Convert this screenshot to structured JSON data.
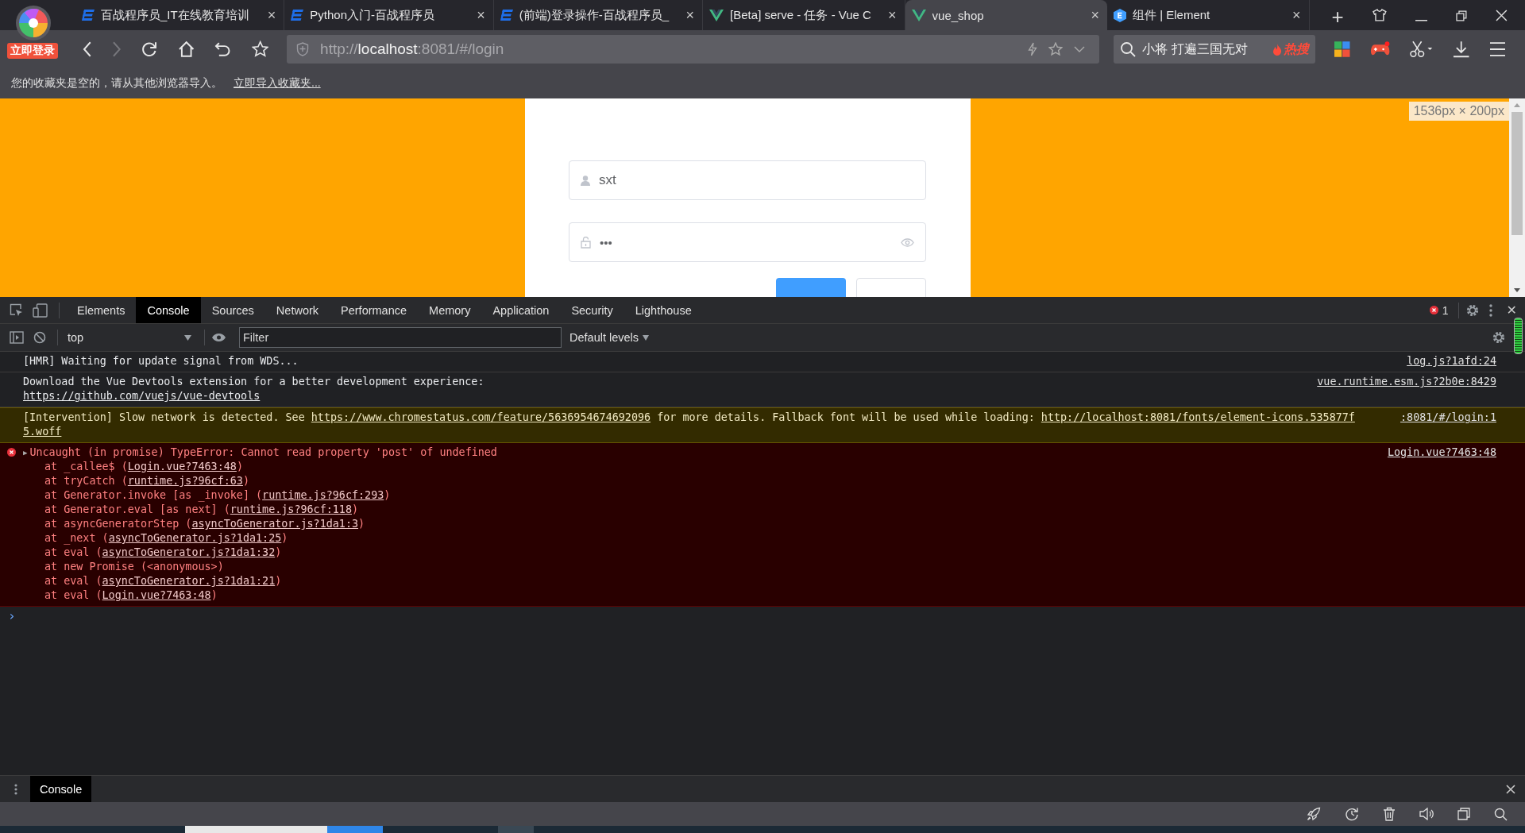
{
  "browser": {
    "login_badge": "立即登录",
    "tabs": [
      {
        "title": "百战程序员_IT在线教育培训",
        "kind": "bz",
        "selected": false,
        "close": "×"
      },
      {
        "title": "Python入门-百战程序员",
        "kind": "bz",
        "selected": false,
        "close": "×"
      },
      {
        "title": "(前端)登录操作-百战程序员_",
        "kind": "bz",
        "selected": false,
        "close": "×"
      },
      {
        "title": "[Beta] serve - 任务 - Vue C",
        "kind": "vue",
        "selected": false,
        "close": "×"
      },
      {
        "title": "vue_shop",
        "kind": "vue",
        "selected": true,
        "close": "×"
      },
      {
        "title": "组件 | Element",
        "kind": "element",
        "selected": false,
        "close": "×"
      }
    ],
    "new_tab": "+",
    "address": {
      "scheme": "http://",
      "host": "localhost",
      "rest": ":8081/#/login"
    },
    "search": {
      "value": "小将 打遍三国无对",
      "hot": "热搜"
    },
    "bookmarks": {
      "message": "您的收藏夹是空的，请从其他浏览器导入。",
      "link": "立即导入收藏夹..."
    }
  },
  "page": {
    "size_label": "1536px × 200px",
    "username": "sxt",
    "password": "•••"
  },
  "devtools": {
    "tabs": [
      {
        "label": "Elements",
        "selected": false
      },
      {
        "label": "Console",
        "selected": true
      },
      {
        "label": "Sources",
        "selected": false
      },
      {
        "label": "Network",
        "selected": false
      },
      {
        "label": "Performance",
        "selected": false
      },
      {
        "label": "Memory",
        "selected": false
      },
      {
        "label": "Application",
        "selected": false
      },
      {
        "label": "Security",
        "selected": false
      },
      {
        "label": "Lighthouse",
        "selected": false
      }
    ],
    "error_count": "1",
    "close": "✕",
    "context": "top",
    "filter_placeholder": "Filter",
    "levels": "Default levels",
    "messages": [
      {
        "kind": "info",
        "source": "log.js?1afd:24",
        "lines": [
          [
            {
              "text": "[HMR] Waiting for update signal from WDS...",
              "kind": "text"
            }
          ]
        ]
      },
      {
        "kind": "info",
        "source": "vue.runtime.esm.js?2b0e:8429",
        "lines": [
          [
            {
              "text": "Download the Vue Devtools extension for a better development experience:",
              "kind": "text"
            }
          ],
          [
            {
              "text": "https://github.com/vuejs/vue-devtools",
              "kind": "link"
            }
          ]
        ]
      },
      {
        "kind": "warning",
        "source": ":8081/#/login:1",
        "lines": [
          [
            {
              "text": "[Intervention] Slow network is detected. See ",
              "kind": "text"
            },
            {
              "text": "https://www.chromestatus.com/feature/5636954674692096",
              "kind": "link"
            },
            {
              "text": " for more details. Fallback font will be used while loading: ",
              "kind": "text"
            },
            {
              "text": "http://localhost:8081/fonts/element-icons.535877f",
              "kind": "link"
            }
          ],
          [
            {
              "text": "5.woff",
              "kind": "link"
            }
          ]
        ]
      },
      {
        "kind": "error",
        "toggle": "▶",
        "source": "Login.vue?7463:48",
        "lines": [
          [
            {
              "text": "Uncaught (in promise) TypeError: Cannot read property 'post' of undefined",
              "kind": "text"
            }
          ],
          [
            {
              "text": "at _callee$ (",
              "kind": "text"
            },
            {
              "text": "Login.vue?7463:48",
              "kind": "link"
            },
            {
              "text": ")",
              "kind": "text"
            }
          ],
          [
            {
              "text": "at tryCatch (",
              "kind": "text"
            },
            {
              "text": "runtime.js?96cf:63",
              "kind": "link"
            },
            {
              "text": ")",
              "kind": "text"
            }
          ],
          [
            {
              "text": "at Generator.invoke [as _invoke] (",
              "kind": "text"
            },
            {
              "text": "runtime.js?96cf:293",
              "kind": "link"
            },
            {
              "text": ")",
              "kind": "text"
            }
          ],
          [
            {
              "text": "at Generator.eval [as next] (",
              "kind": "text"
            },
            {
              "text": "runtime.js?96cf:118",
              "kind": "link"
            },
            {
              "text": ")",
              "kind": "text"
            }
          ],
          [
            {
              "text": "at asyncGeneratorStep (",
              "kind": "text"
            },
            {
              "text": "asyncToGenerator.js?1da1:3",
              "kind": "link"
            },
            {
              "text": ")",
              "kind": "text"
            }
          ],
          [
            {
              "text": "at _next (",
              "kind": "text"
            },
            {
              "text": "asyncToGenerator.js?1da1:25",
              "kind": "link"
            },
            {
              "text": ")",
              "kind": "text"
            }
          ],
          [
            {
              "text": "at eval (",
              "kind": "text"
            },
            {
              "text": "asyncToGenerator.js?1da1:32",
              "kind": "link"
            },
            {
              "text": ")",
              "kind": "text"
            }
          ],
          [
            {
              "text": "at new Promise (<anonymous>)",
              "kind": "text"
            }
          ],
          [
            {
              "text": "at eval (",
              "kind": "text"
            },
            {
              "text": "asyncToGenerator.js?1da1:21",
              "kind": "link"
            },
            {
              "text": ")",
              "kind": "text"
            }
          ],
          [
            {
              "text": "at eval (",
              "kind": "text"
            },
            {
              "text": "Login.vue?7463:48",
              "kind": "link"
            },
            {
              "text": ")",
              "kind": "text"
            }
          ]
        ]
      }
    ],
    "prompt": "›",
    "drawer_tab": "Console"
  }
}
